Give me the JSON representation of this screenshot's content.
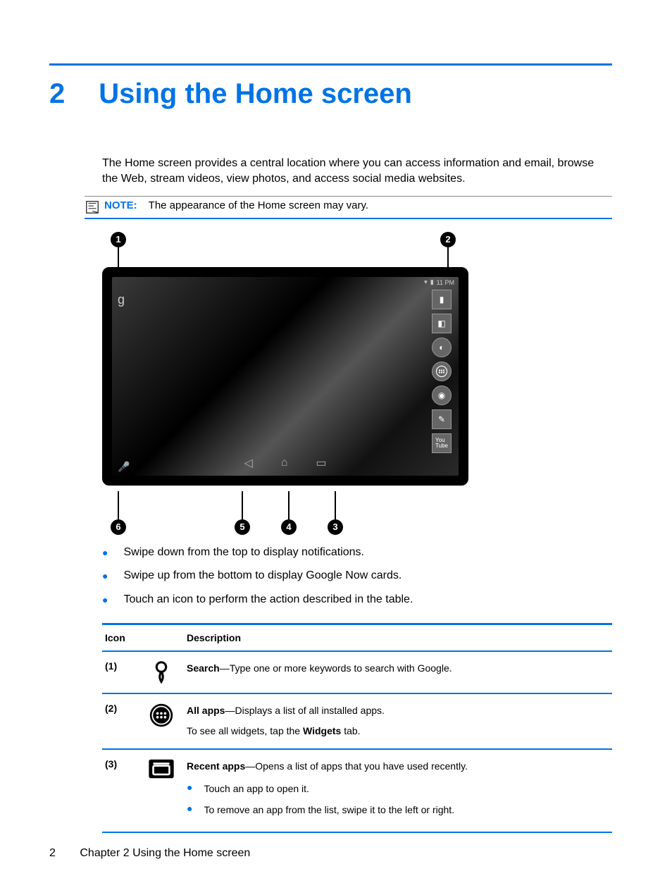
{
  "chapter": {
    "number": "2",
    "title": "Using the Home screen"
  },
  "intro": "The Home screen provides a central location where you can access information and email, browse the Web, stream videos, view photos, and access social media websites.",
  "note": {
    "label": "NOTE:",
    "text": "The appearance of the Home screen may vary."
  },
  "callouts": {
    "c1": "1",
    "c2": "2",
    "c3": "3",
    "c4": "4",
    "c5": "5",
    "c6": "6"
  },
  "figure_status": "11 PM",
  "bullets": [
    "Swipe down from the top to display notifications.",
    "Swipe up from the bottom to display Google Now cards.",
    "Touch an icon to perform the action described in the table."
  ],
  "table": {
    "headers": {
      "icon": "Icon",
      "desc": "Description"
    },
    "rows": [
      {
        "num": "(1)",
        "icon_name": "search-icon",
        "term": "Search",
        "desc": "—Type one or more keywords to search with Google."
      },
      {
        "num": "(2)",
        "icon_name": "all-apps-icon",
        "term": "All apps",
        "desc": "—Displays a list of all installed apps.",
        "extra_pre": "To see all widgets, tap the ",
        "extra_bold": "Widgets",
        "extra_post": " tab."
      },
      {
        "num": "(3)",
        "icon_name": "recent-apps-icon",
        "term": "Recent apps",
        "desc": "—Opens a list of apps that you have used recently.",
        "sub": [
          "Touch an app to open it.",
          "To remove an app from the list, swipe it to the left or right."
        ]
      }
    ]
  },
  "footer": {
    "page": "2",
    "text": "Chapter 2   Using the Home screen"
  }
}
